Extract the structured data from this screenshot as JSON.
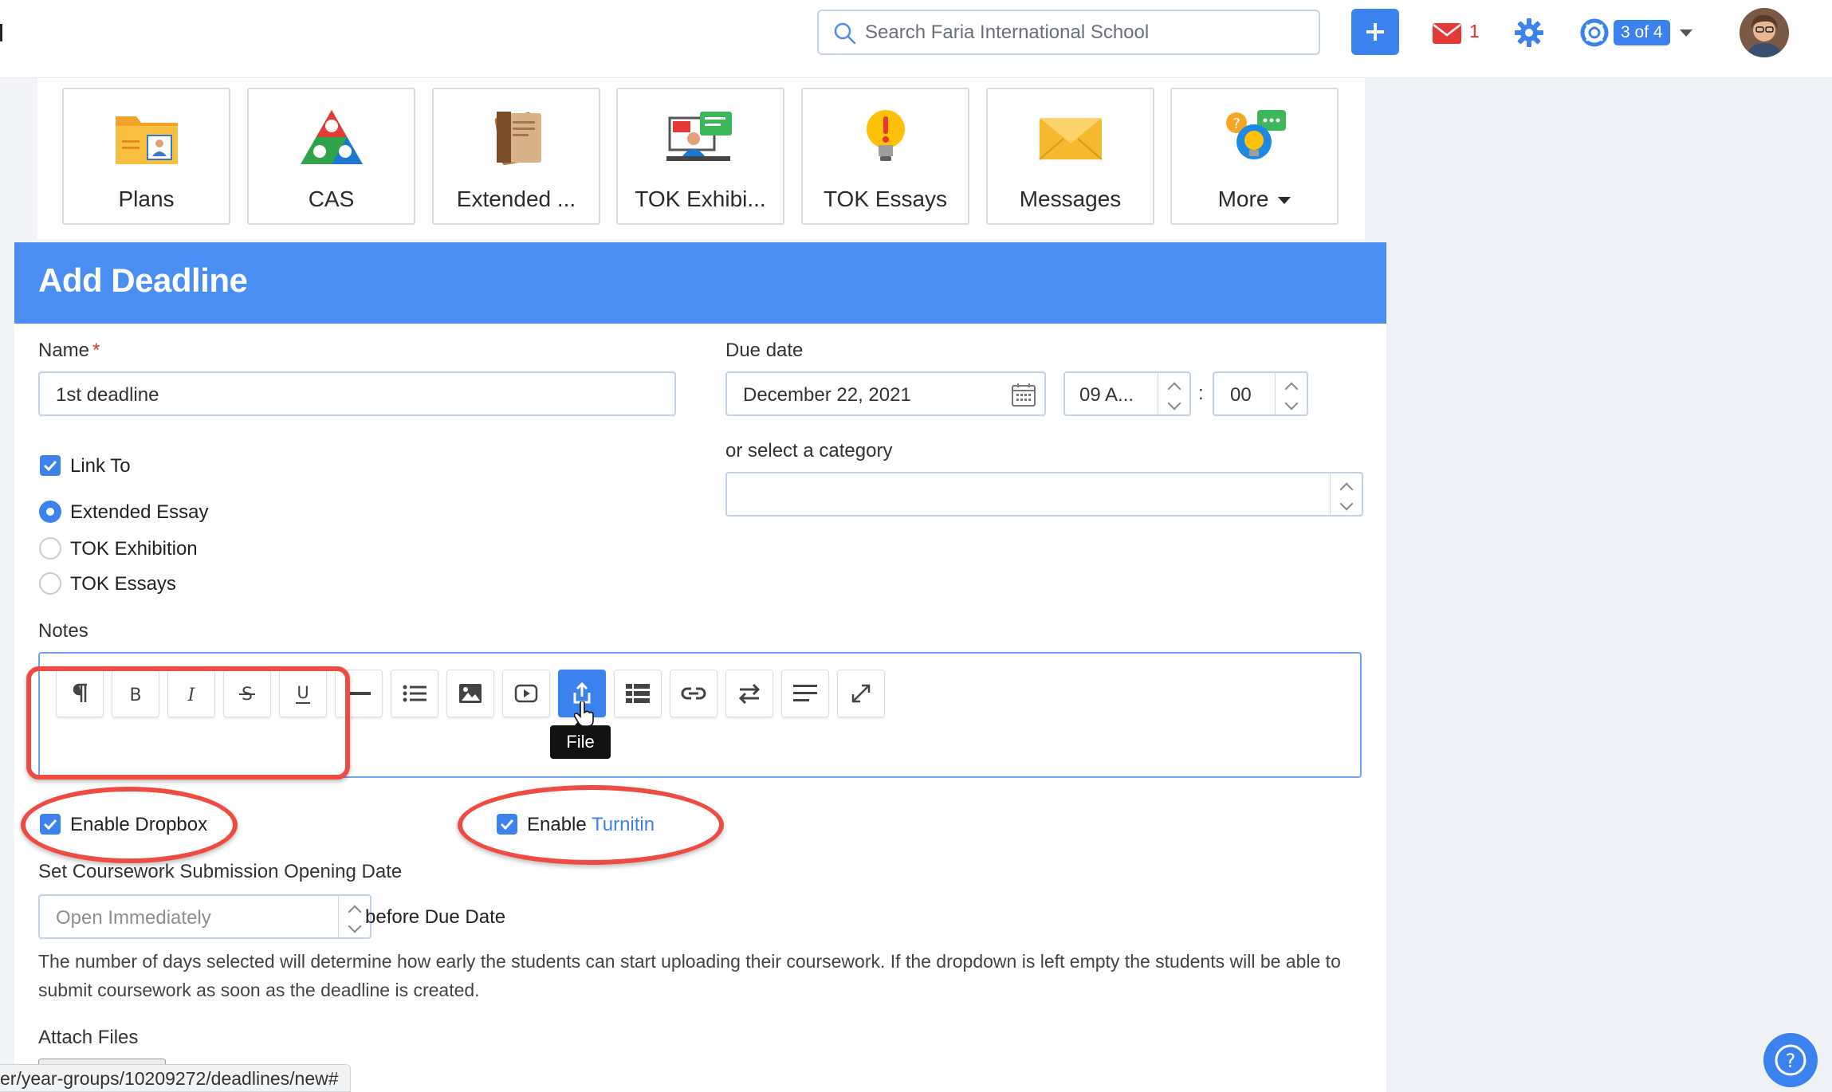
{
  "topbar": {
    "search_placeholder": "Search Faria International School",
    "mail_count": "1",
    "help_badge": "3 of 4"
  },
  "tiles": [
    {
      "label": "Plans",
      "icon": "plans-folder-icon"
    },
    {
      "label": "CAS",
      "icon": "cas-triangle-icon"
    },
    {
      "label": "Extended ...",
      "icon": "extended-essay-books-icon"
    },
    {
      "label": "TOK Exhibi...",
      "icon": "tok-exhibition-icon"
    },
    {
      "label": "TOK Essays",
      "icon": "lightbulb-icon"
    },
    {
      "label": "Messages",
      "icon": "envelope-icon"
    },
    {
      "label": "More",
      "icon": "more-apps-icon"
    }
  ],
  "modal": {
    "title": "Add Deadline",
    "name_label": "Name",
    "name_required": "*",
    "name_value": "1st deadline",
    "due_date_label": "Due date",
    "due_date_value": "December 22, 2021",
    "hour_value": "09 A...",
    "time_separator": ":",
    "minute_value": "00",
    "category_label": "or select a category",
    "category_value": "",
    "link_to_label": "Link To",
    "link_options": [
      "Extended Essay",
      "TOK Exhibition",
      "TOK Essays"
    ],
    "link_selected": "Extended Essay",
    "notes_label": "Notes",
    "toolbar_tooltip": "File",
    "toolbar_buttons": [
      "paragraph",
      "bold",
      "italic",
      "strikethrough",
      "underline",
      "horizontal-rule",
      "list",
      "image",
      "video",
      "file",
      "table",
      "link",
      "text-direction",
      "align",
      "fullscreen"
    ],
    "enable_dropbox_label": "Enable Dropbox",
    "enable_turnitin_prefix": "Enable",
    "enable_turnitin_link": "Turnitin",
    "opening_date_label": "Set Coursework Submission Opening Date",
    "opening_placeholder": "Open Immediately",
    "before_due_text": "before Due Date",
    "help_text": "The number of days selected will determine how early the students can start uploading their coursework. If the dropdown is left empty the students will be able to submit coursework as soon as the deadline is created.",
    "attach_files_label": "Attach Files"
  },
  "status_url": "er/year-groups/10209272/deadlines/new#",
  "colors": {
    "accent": "#3c82ee",
    "header": "#4a8ef3",
    "annotation": "#ee4b42"
  }
}
